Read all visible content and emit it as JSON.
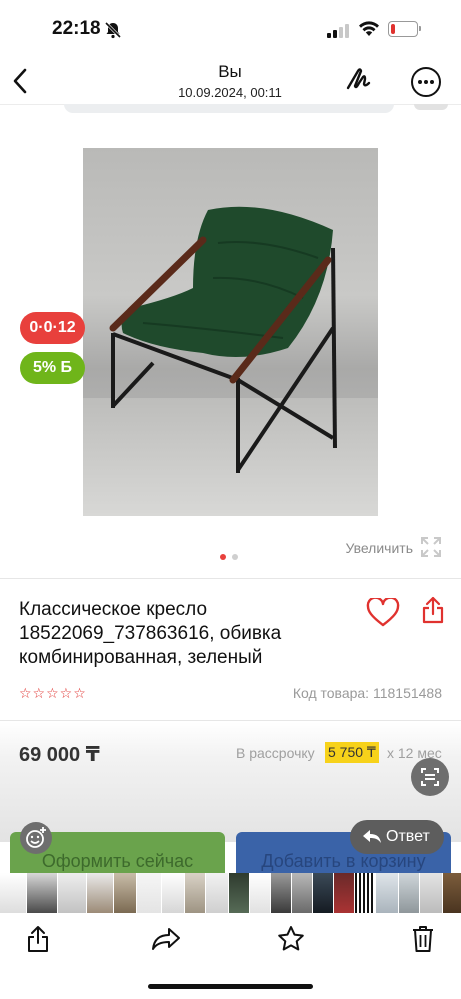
{
  "status_bar": {
    "time": "22:18"
  },
  "header": {
    "sender": "Вы",
    "date": "10.09.2024, 00:11"
  },
  "product": {
    "badge_installment": "0·0·12",
    "badge_bonus": "5% Б",
    "zoom_label": "Увеличить",
    "title": "Классическое кресло 18522069_737863616, обивка комбинированная, зеленый",
    "rating_stars": "☆☆☆☆☆",
    "code": "Код товара: 118151488",
    "price": "69 000 ₸",
    "installment_label": "В рассрочку",
    "installment_value": "5 750 ₸",
    "installment_months": "x 12 мес",
    "checkout_label": "Оформить сейчас",
    "cart_label": "Добавить в корзину"
  },
  "reply_label": "Ответ",
  "colors": {
    "accent_red": "#e8403c",
    "bonus_green": "#6fb51a",
    "installment_yellow": "#f7d21a"
  }
}
